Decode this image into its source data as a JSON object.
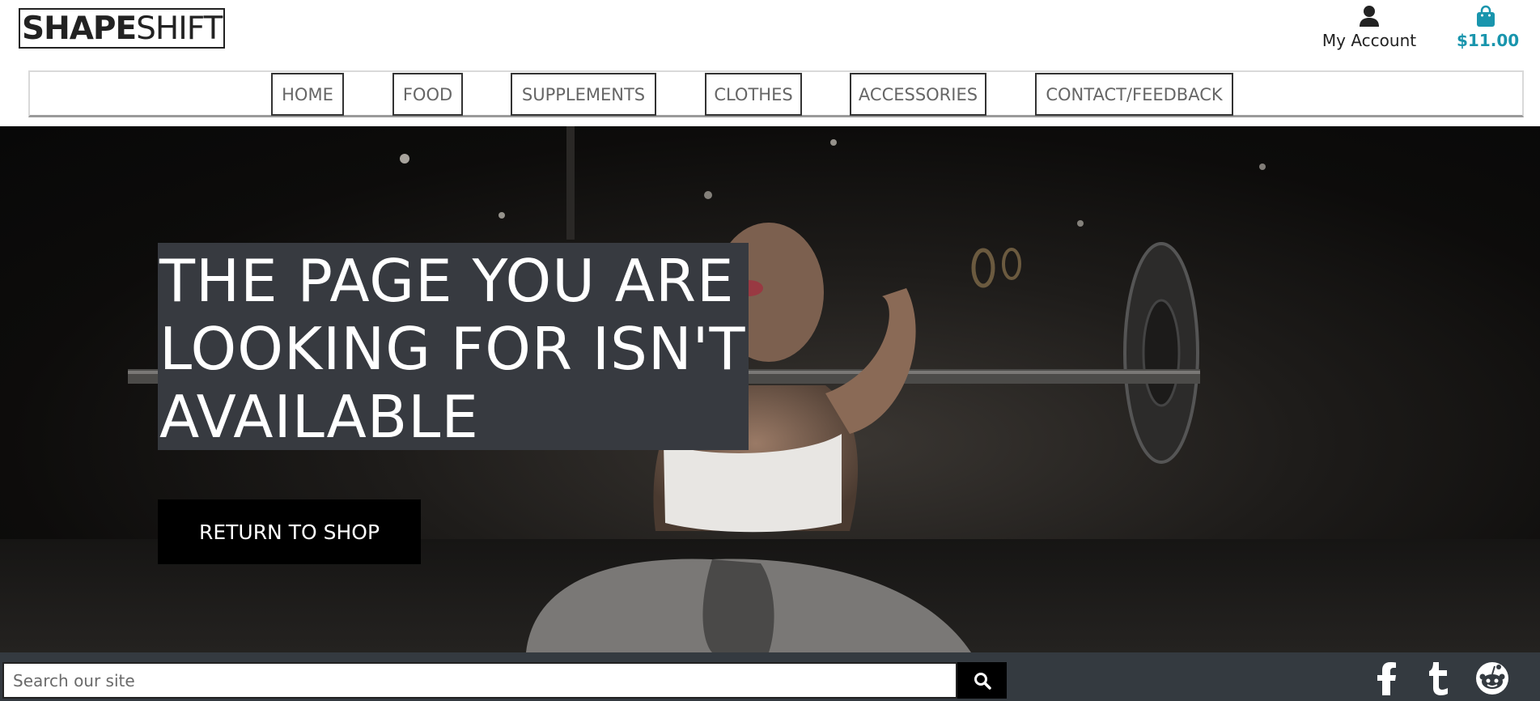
{
  "header": {
    "logo_bold": "SHAPE",
    "logo_light": "SHIFT",
    "account_label": "My Account",
    "account_icon": "user-icon",
    "cart_total": "$11.00",
    "cart_icon": "shopping-bag-icon"
  },
  "nav": {
    "items": [
      {
        "label": "HOME"
      },
      {
        "label": "FOOD"
      },
      {
        "label": "SUPPLEMENTS"
      },
      {
        "label": "CLOTHES"
      },
      {
        "label": "ACCESSORIES"
      },
      {
        "label": "CONTACT/FEEDBACK"
      }
    ]
  },
  "hero": {
    "headline": "THE PAGE YOU ARE LOOKING FOR ISN'T AVAILABLE",
    "button_label": "RETURN TO SHOP"
  },
  "footer": {
    "search_placeholder": "Search our site",
    "search_icon": "search-icon",
    "social_icons": [
      "facebook-icon",
      "tumblr-icon",
      "reddit-icon"
    ]
  },
  "colors": {
    "accent": "#1995ad",
    "footer_bg": "#343a40",
    "headline_bg": "#373a40",
    "button_bg": "#000000"
  }
}
